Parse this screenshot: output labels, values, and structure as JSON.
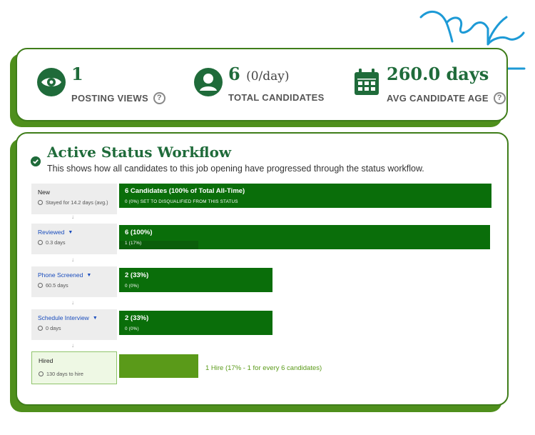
{
  "stats": {
    "views": {
      "value": "1",
      "label": "POSTING VIEWS",
      "help": "?",
      "icon": "eye-icon"
    },
    "candidates": {
      "value": "6",
      "rate": "(0/day)",
      "label": "TOTAL CANDIDATES",
      "icon": "person-icon"
    },
    "age": {
      "value": "260.0 days",
      "label": "AVG CANDIDATE AGE",
      "help": "?",
      "icon": "calendar-icon"
    }
  },
  "workflow": {
    "title": "Active Status Workflow",
    "description": "This shows how all candidates to this job opening have progressed through the status workflow.",
    "arrow": "↓",
    "steps": [
      {
        "name": "New",
        "duration": "Stayed for 14.2 days (avg.)",
        "bar_main": "6 Candidates (100% of Total All-Time)",
        "bar_sub": "0 (0%) SET TO DISQUALIFIED FROM THIS STATUS",
        "fraction": 1.0,
        "sub_fraction": 0.0
      },
      {
        "name": "Reviewed",
        "duration": "0.3 days",
        "bar_main": "6 (100%)",
        "bar_sub": "1 (17%)",
        "fraction": 1.0,
        "sub_fraction": 0.17
      },
      {
        "name": "Phone Screened",
        "duration": "60.5 days",
        "bar_main": "2 (33%)",
        "bar_sub": "0 (0%)",
        "fraction": 0.33,
        "sub_fraction": 0.0
      },
      {
        "name": "Schedule Interview",
        "duration": "0 days",
        "bar_main": "2 (33%)",
        "bar_sub": "0 (0%)",
        "fraction": 0.33,
        "sub_fraction": 0.0
      }
    ],
    "hired": {
      "name": "Hired",
      "duration": "130 days to hire",
      "summary": "1 Hire (17% - 1 for every 6 candidates)",
      "fraction": 0.17
    }
  },
  "colors": {
    "brand_green": "#1f6b3a",
    "bar_green": "#0a6e0a",
    "hire_green": "#5a9a19",
    "link_blue": "#1a4dbd",
    "squiggle_blue": "#1d9ad6"
  }
}
